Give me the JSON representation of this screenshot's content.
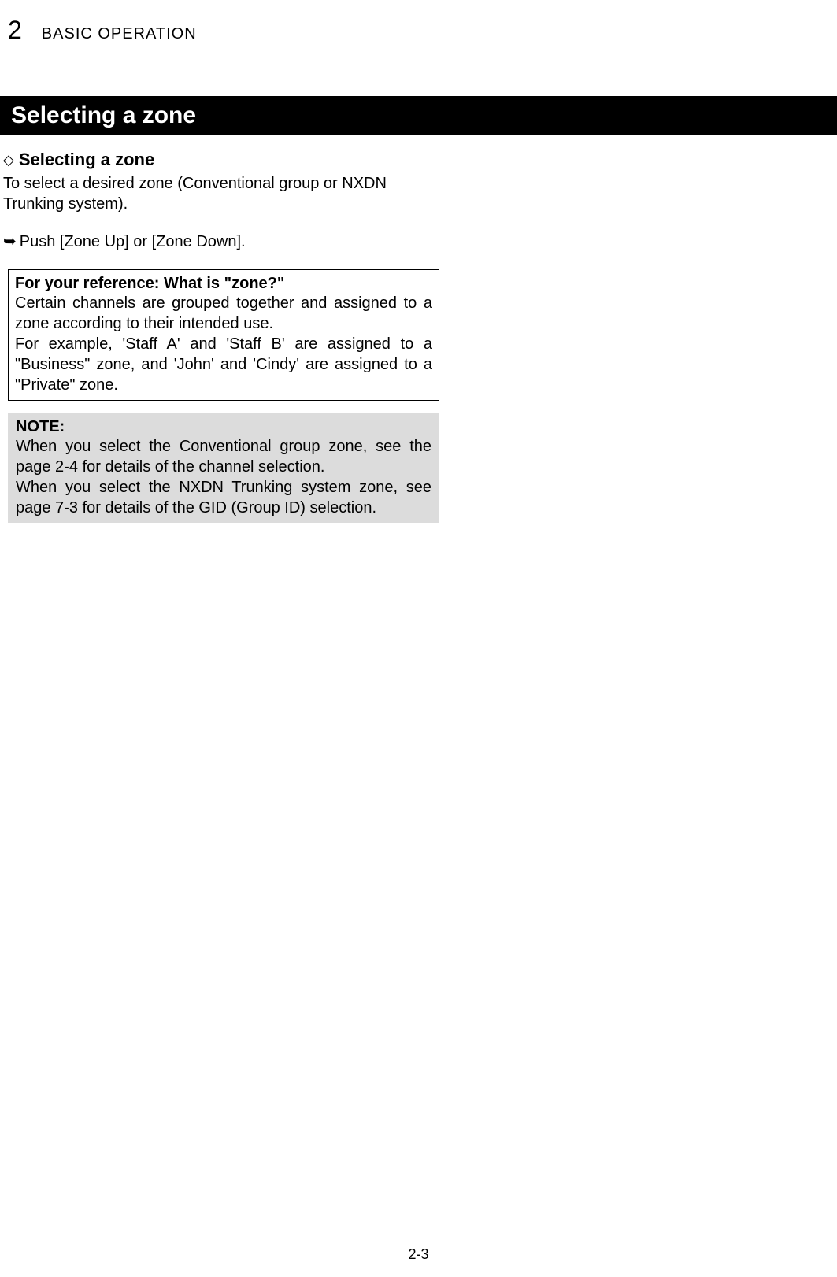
{
  "header": {
    "chapter_number": "2",
    "chapter_title": "BASIC OPERATION"
  },
  "section": {
    "banner": "Selecting a zone",
    "subsection_title": "Selecting a zone",
    "intro": "To select a desired zone (Conventional group or NXDN Trunking system).",
    "instruction": "Push [Zone Up] or [Zone Down]."
  },
  "reference": {
    "title": "For your reference: What is \"zone?\"",
    "body_1": "Certain channels are grouped together and assigned to a zone according to their intended use.",
    "body_2": "For example, 'Staff A' and 'Staff B' are assigned to a \"Business\" zone, and 'John' and 'Cindy' are assigned to a \"Private\" zone."
  },
  "note": {
    "title": "NOTE:",
    "body_1": "When you select the Conventional group zone, see the page 2-4 for details of the channel selection.",
    "body_2": "When you select the NXDN Trunking system zone, see page 7-3 for details of the GID (Group ID) selection."
  },
  "page_number": "2-3"
}
